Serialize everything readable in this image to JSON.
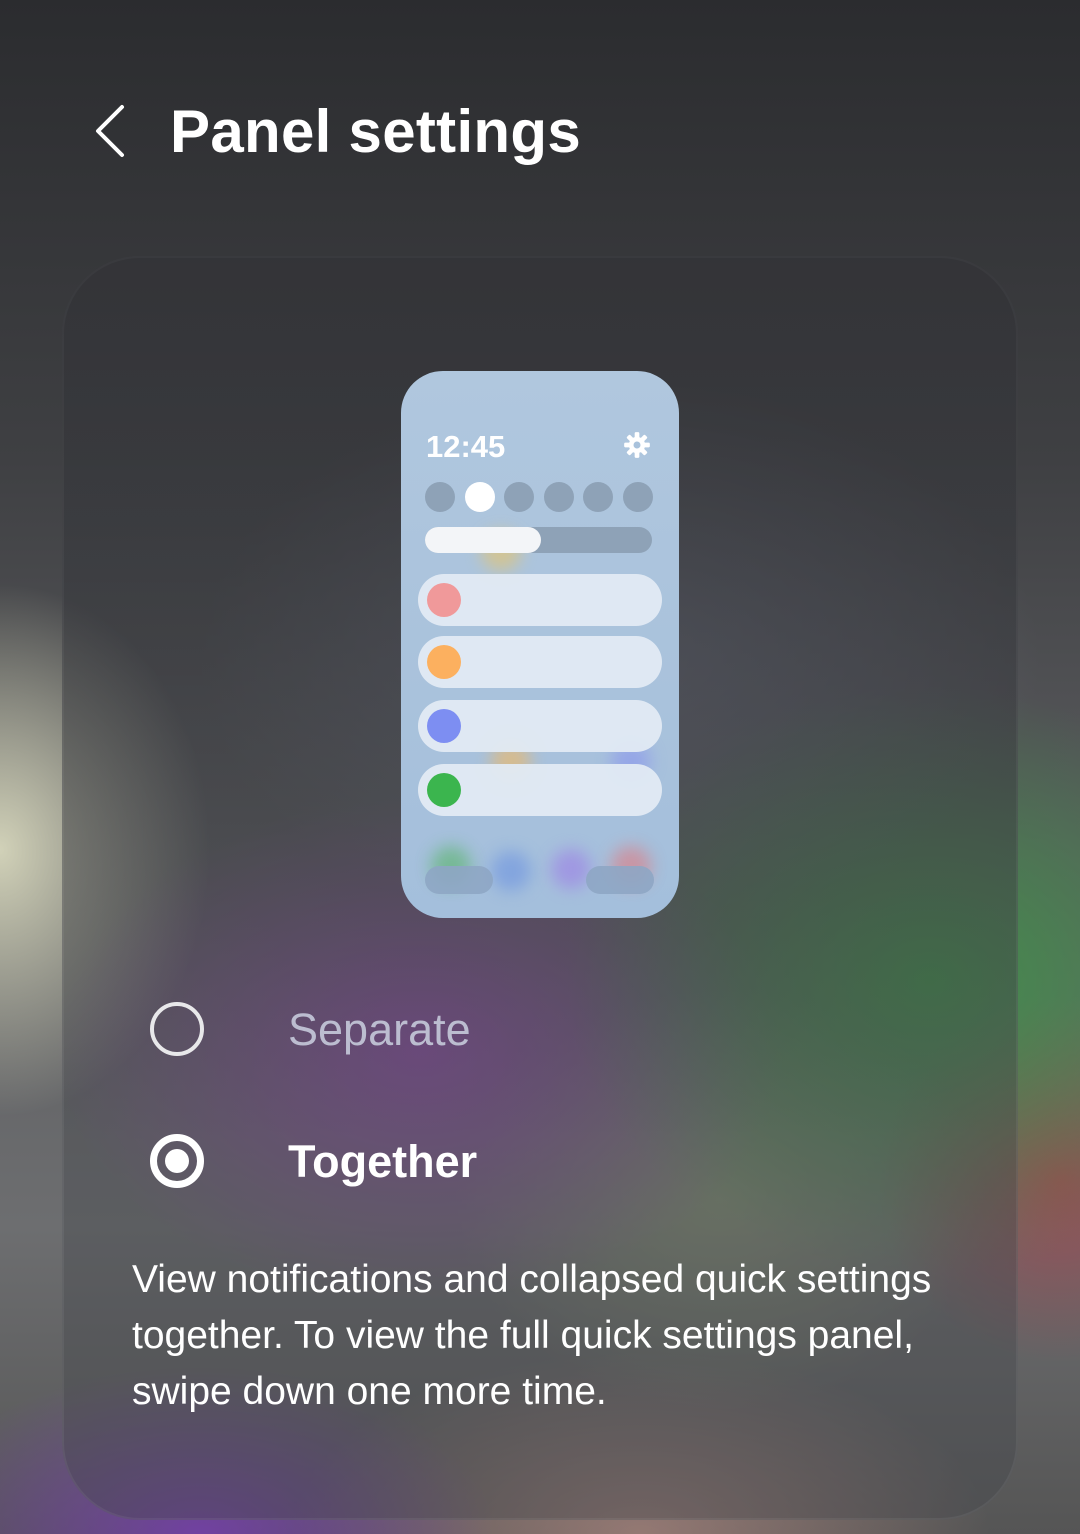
{
  "header": {
    "title": "Panel settings",
    "back_icon": "chevron-left-icon"
  },
  "preview": {
    "time": "12:45",
    "settings_icon": "gear-icon",
    "brightness_level": 0.51,
    "active_toggle_index": 1,
    "row_colors": [
      "#f0999a",
      "#fcb05f",
      "#7d8ef2",
      "#3bb54e"
    ]
  },
  "options": [
    {
      "label": "Separate",
      "selected": false
    },
    {
      "label": "Together",
      "selected": true
    }
  ],
  "description": "View notifications and collapsed quick settings together. To view the full quick settings panel, swipe down one more time."
}
